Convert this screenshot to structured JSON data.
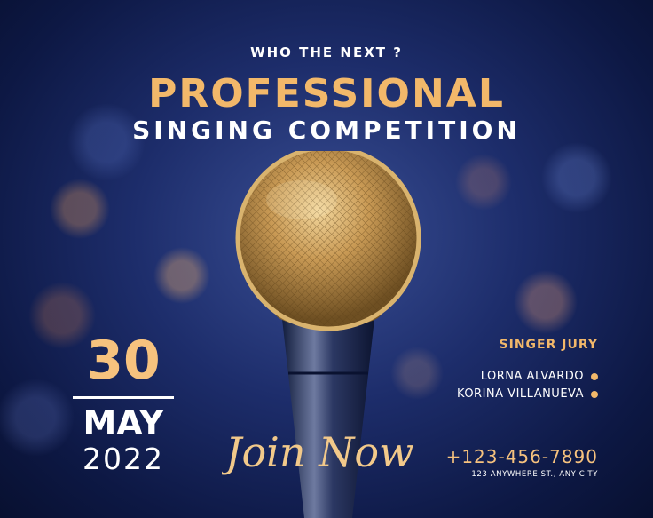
{
  "header": {
    "tagline": "WHO THE NEXT ?",
    "title_line1": "PROFESSIONAL",
    "title_line2": "SINGING COMPETITION"
  },
  "event_date": {
    "day": "30",
    "month": "MAY",
    "year": "2022"
  },
  "cta": {
    "script_text": "Join Now"
  },
  "jury": {
    "heading": "SINGER JURY",
    "members": [
      "LORNA ALVARDO",
      "KORINA VILLANUEVA"
    ]
  },
  "contact": {
    "phone": "+123-456-7890",
    "address": "123 ANYWHERE ST., ANY CITY"
  },
  "colors": {
    "accent_gold": "#f2b86a",
    "background_navy": "#1d2d6b",
    "text_white": "#ffffff"
  },
  "icons": [
    "microphone-image",
    "bullet-dot"
  ]
}
